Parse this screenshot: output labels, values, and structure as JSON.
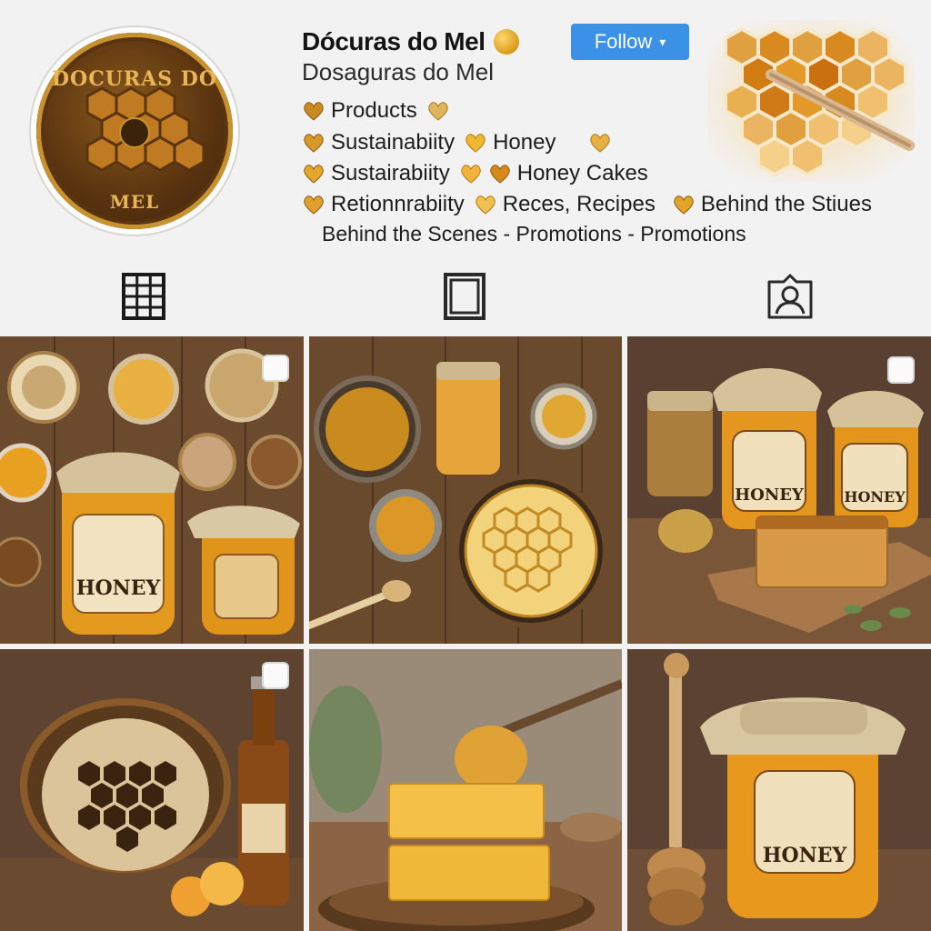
{
  "profile": {
    "avatar_text_top": "DOCURAS DO",
    "avatar_text_bottom": "MEL",
    "name": "Dócuras do Mel",
    "handle": "Dosaguras do Mel",
    "follow_label": "Follow",
    "follow_caret": "▾",
    "accent_color": "#3b91e6",
    "gold_color": "#d99a1a"
  },
  "bio": {
    "line1": [
      "Products"
    ],
    "line2": [
      "Sustainabiity",
      "Honey"
    ],
    "line3": [
      "Sustairabiity",
      "Honey Cakes"
    ],
    "line4": [
      "Retionnrabiity",
      "Reces, Recipes",
      "Behind the Stiues"
    ],
    "line5": "Behind the Scenes - Promotions - Promotions"
  },
  "tabs": [
    {
      "icon": "grid-icon"
    },
    {
      "icon": "reels-icon"
    },
    {
      "icon": "tagged-icon"
    }
  ],
  "posts": [
    {
      "label": "HONEY",
      "icon": "multi-post-icon"
    },
    {
      "label": "",
      "icon": "multi-post-icon"
    },
    {
      "label": "HONEY",
      "label2": "HONEY",
      "icon": "multi-post-icon"
    },
    {
      "label": "",
      "icon": "multi-post-icon"
    },
    {
      "label": ""
    },
    {
      "label": "HONEY"
    }
  ]
}
